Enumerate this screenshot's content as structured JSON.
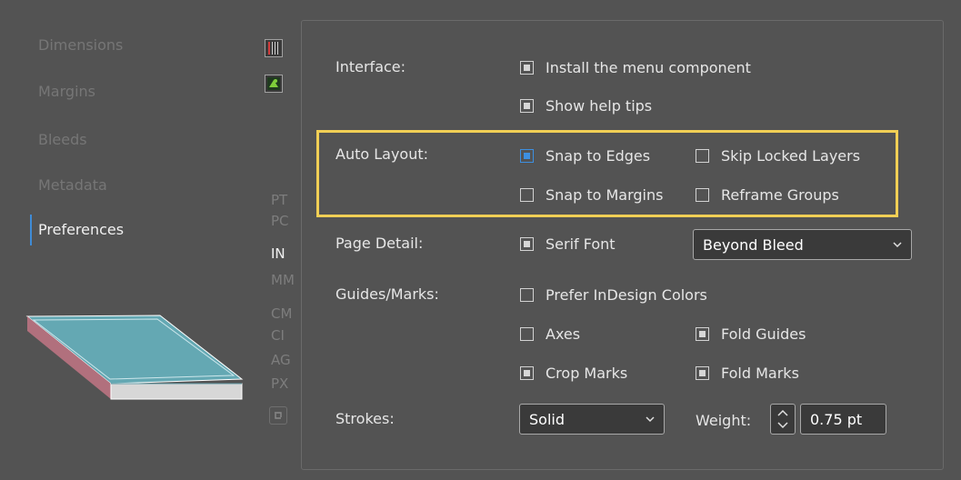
{
  "sidebar": {
    "items": [
      {
        "label": "Dimensions"
      },
      {
        "label": "Margins"
      },
      {
        "label": "Bleeds"
      },
      {
        "label": "Metadata"
      },
      {
        "label": "Preferences"
      }
    ],
    "units": [
      "PT",
      "PC",
      "IN",
      "MM",
      "CM",
      "CI",
      "AG",
      "PX"
    ],
    "active_unit": "IN",
    "active_item": "Preferences",
    "icons": [
      "ruler-icon",
      "plugin-icon",
      "reset-units-icon"
    ]
  },
  "interface": {
    "label": "Interface:",
    "install_menu": {
      "label": "Install the menu component",
      "checked": true
    },
    "help_tips": {
      "label": "Show help tips",
      "checked": true
    }
  },
  "auto_layout": {
    "label": "Auto Layout:",
    "snap_edges": {
      "label": "Snap to Edges",
      "checked": true
    },
    "skip_locked": {
      "label": "Skip Locked Layers",
      "checked": false
    },
    "snap_margins": {
      "label": "Snap to Margins",
      "checked": false
    },
    "reframe_groups": {
      "label": "Reframe Groups",
      "checked": false
    }
  },
  "page_detail": {
    "label": "Page Detail:",
    "serif_font": {
      "label": "Serif Font",
      "checked": true
    },
    "select_value": "Beyond Bleed"
  },
  "guides": {
    "label": "Guides/Marks:",
    "prefer_colors": {
      "label": "Prefer InDesign Colors",
      "checked": false
    },
    "axes": {
      "label": "Axes",
      "checked": false
    },
    "fold_guides": {
      "label": "Fold Guides",
      "checked": true
    },
    "crop_marks": {
      "label": "Crop Marks",
      "checked": true
    },
    "fold_marks": {
      "label": "Fold Marks",
      "checked": true
    }
  },
  "strokes": {
    "label": "Strokes:",
    "select_value": "Solid",
    "weight_label": "Weight:",
    "weight_value": "0.75 pt"
  },
  "colors": {
    "highlight": "#f1cf55",
    "accent": "#3d8fe0",
    "background": "#535353"
  }
}
